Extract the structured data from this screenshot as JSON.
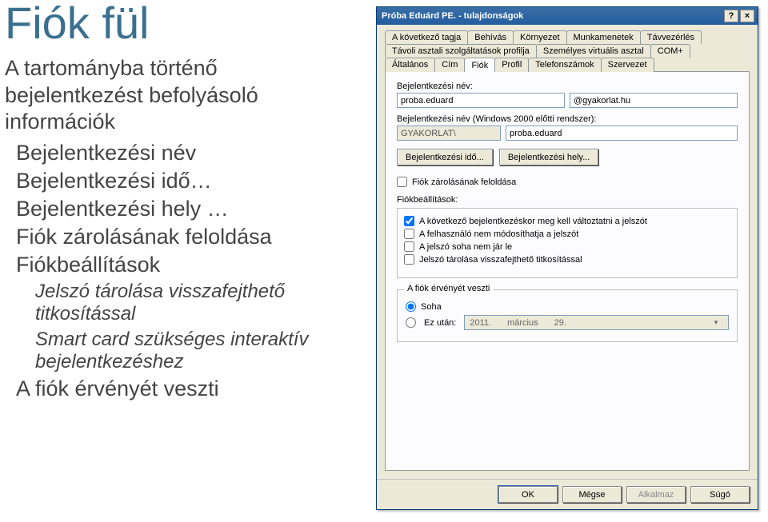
{
  "slide": {
    "title": "Fiók fül",
    "lead": "A tartományba történő bejelentkezést befolyásoló információk",
    "items": [
      "Bejelentkezési név",
      "Bejelentkezési idő…",
      "Bejelentkezési hely …",
      "Fiók zárolásának feloldása",
      "Fiókbeállítások"
    ],
    "subitems": [
      "Jelszó tárolása visszafejthető titkosítással",
      "Smart card szükséges interaktív bejelentkezéshez"
    ],
    "final": "A fiók érvényét veszti"
  },
  "dialog": {
    "title": "Próba Eduárd PE. - tulajdonságok",
    "help_btn": "?",
    "close_btn": "×",
    "tabs_row1": [
      "A következő tagja",
      "Behívás",
      "Környezet",
      "Munkamenetek",
      "Távvezérlés"
    ],
    "tabs_row2": [
      "Távoli asztali szolgáltatások profilja",
      "Személyes virtuális asztal",
      "COM+"
    ],
    "tabs_row3": [
      "Általános",
      "Cím",
      "Fiók",
      "Profil",
      "Telefonszámok",
      "Szervezet"
    ],
    "active_tab_index": 2,
    "login_name_label": "Bejelentkezési név:",
    "login_name_value": "proba.eduard",
    "login_domain_value": "@gyakorlat.hu",
    "login_legacy_label": "Bejelentkezési név (Windows 2000 előtti rendszer):",
    "legacy_domain": "GYAKORLAT\\",
    "legacy_user": "proba.eduard",
    "btn_time": "Bejelentkezési idő...",
    "btn_place": "Bejelentkezési hely...",
    "unlock_label": "Fiók zárolásának feloldása",
    "settings_label": "Fiókbeállítások:",
    "opts": [
      {
        "label": "A következő bejelentkezéskor meg kell változtatni a jelszót",
        "checked": true
      },
      {
        "label": "A felhasználó nem módosíthatja a jelszót",
        "checked": false
      },
      {
        "label": "A jelszó soha nem jár le",
        "checked": false
      },
      {
        "label": "Jelszó tárolása visszafejthető titkosítással",
        "checked": false
      }
    ],
    "expiry_legend": "A fiók érvényét veszti",
    "expiry_never": "Soha",
    "expiry_after": "Ez után:",
    "expiry_date_year": "2011.",
    "expiry_date_month": "március",
    "expiry_date_day": "29.",
    "footer": {
      "ok": "OK",
      "cancel": "Mégse",
      "apply": "Alkalmaz",
      "help": "Súgó"
    }
  }
}
